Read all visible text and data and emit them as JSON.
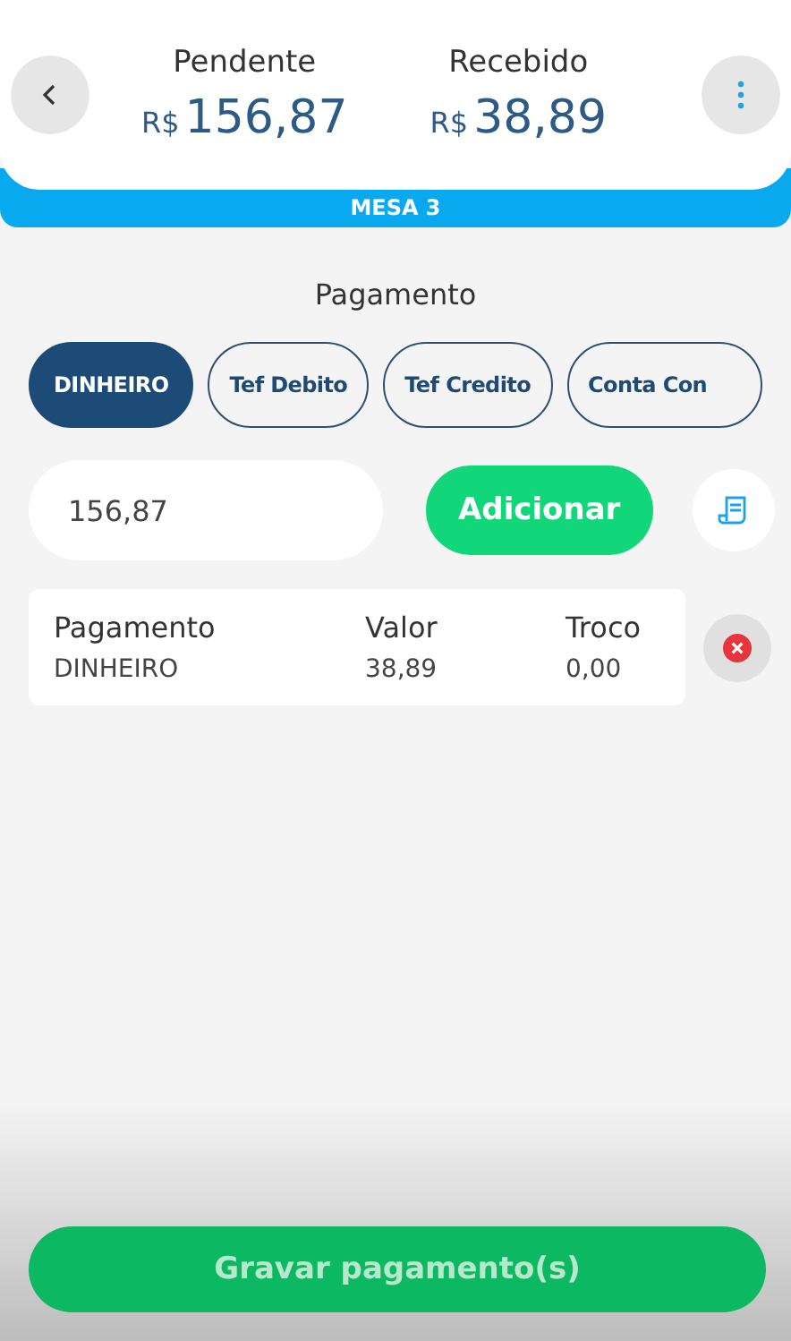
{
  "header": {
    "pending": {
      "label": "Pendente",
      "currency": "R$",
      "amount": "156,87"
    },
    "received": {
      "label": "Recebido",
      "currency": "R$",
      "amount": "38,89"
    }
  },
  "table_banner": "MESA 3",
  "section_title": "Pagamento",
  "methods": [
    {
      "label": "DINHEIRO",
      "selected": true
    },
    {
      "label": "Tef Debito",
      "selected": false
    },
    {
      "label": "Tef Credito",
      "selected": false
    },
    {
      "label": "Conta Con",
      "selected": false
    }
  ],
  "amount_field": {
    "value": "156,87"
  },
  "add_button": "Adicionar",
  "payments": {
    "columns": [
      "Pagamento",
      "Valor",
      "Troco"
    ],
    "rows": [
      [
        "DINHEIRO",
        "38,89",
        "0,00"
      ]
    ]
  },
  "save_button": "Gravar pagamento(s)"
}
